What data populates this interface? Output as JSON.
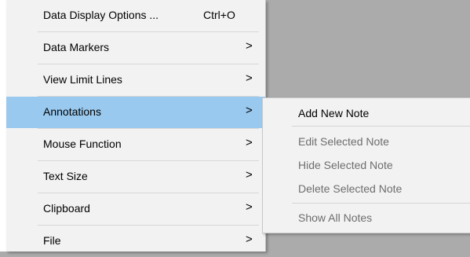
{
  "menu": {
    "items": [
      {
        "label": "Data Display Options ...",
        "shortcut": "Ctrl+O",
        "submenu_arrow": ""
      },
      {
        "label": "Data Markers",
        "shortcut": "",
        "submenu_arrow": ">"
      },
      {
        "label": "View Limit Lines",
        "shortcut": "",
        "submenu_arrow": ">"
      },
      {
        "label": "Annotations",
        "shortcut": "",
        "submenu_arrow": ">"
      },
      {
        "label": "Mouse Function",
        "shortcut": "",
        "submenu_arrow": ">"
      },
      {
        "label": "Text Size",
        "shortcut": "",
        "submenu_arrow": ">"
      },
      {
        "label": "Clipboard",
        "shortcut": "",
        "submenu_arrow": ">"
      },
      {
        "label": "File",
        "shortcut": "",
        "submenu_arrow": ">"
      }
    ],
    "active_index": 3
  },
  "submenu": {
    "items": [
      {
        "label": "Add New Note",
        "enabled": true
      },
      {
        "label": "Edit Selected Note",
        "enabled": false
      },
      {
        "label": "Hide Selected Note",
        "enabled": false
      },
      {
        "label": "Delete Selected  Note",
        "enabled": false
      },
      {
        "label": "Show All Notes",
        "enabled": false
      }
    ]
  },
  "colors": {
    "menu_bg": "#f2f2f2",
    "highlight": "#99c9ef",
    "background": "#ababab",
    "disabled_text": "#6d6d6d"
  }
}
